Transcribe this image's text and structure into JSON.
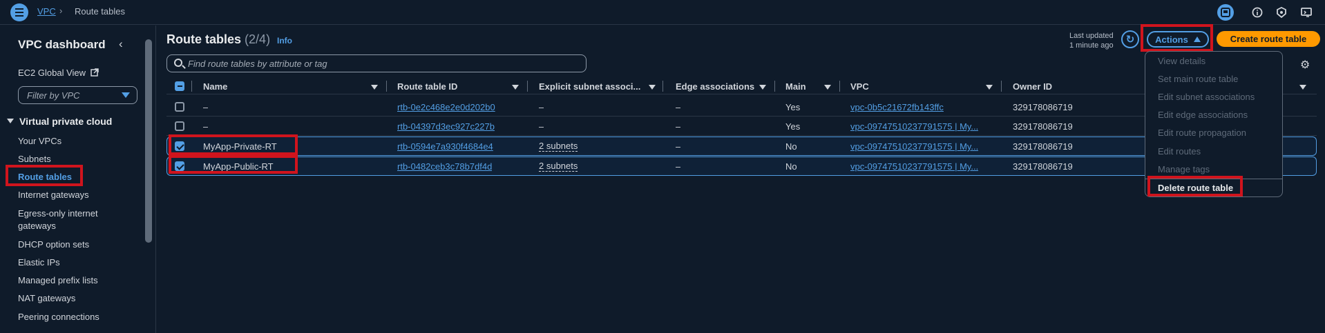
{
  "breadcrumb": {
    "service": "VPC",
    "current": "Route tables"
  },
  "sidebar": {
    "title": "VPC dashboard",
    "ec2_link": "EC2 Global View",
    "filter_placeholder": "Filter by VPC",
    "section": "Virtual private cloud",
    "items": [
      {
        "label": "Your VPCs"
      },
      {
        "label": "Subnets"
      },
      {
        "label": "Route tables"
      },
      {
        "label": "Internet gateways"
      },
      {
        "label": "Egress-only internet"
      },
      {
        "label": "gateways"
      },
      {
        "label": "DHCP option sets"
      },
      {
        "label": "Elastic IPs"
      },
      {
        "label": "Managed prefix lists"
      },
      {
        "label": "NAT gateways"
      },
      {
        "label": "Peering connections"
      }
    ]
  },
  "header": {
    "title": "Route tables",
    "count": "(2/4)",
    "info": "Info",
    "last_updated_label": "Last updated",
    "last_updated_value": "1 minute ago",
    "actions_label": "Actions",
    "create_label": "Create route table"
  },
  "search": {
    "placeholder": "Find route tables by attribute or tag"
  },
  "table": {
    "columns": [
      "Name",
      "Route table ID",
      "Explicit subnet associ...",
      "Edge associations",
      "Main",
      "VPC",
      "Owner ID"
    ],
    "rows": [
      {
        "name": "–",
        "id": "rtb-0e2c468e2e0d202b0",
        "subnets": "–",
        "edge": "–",
        "main": "Yes",
        "vpc": "vpc-0b5c21672fb143ffc",
        "owner": "329178086719",
        "selected": false
      },
      {
        "name": "–",
        "id": "rtb-04397d3ec927c227b",
        "subnets": "–",
        "edge": "–",
        "main": "Yes",
        "vpc": "vpc-09747510237791575 | My...",
        "owner": "329178086719",
        "selected": false
      },
      {
        "name": "MyApp-Private-RT",
        "id": "rtb-0594e7a930f4684e4",
        "subnets": "2 subnets",
        "edge": "–",
        "main": "No",
        "vpc": "vpc-09747510237791575 | My...",
        "owner": "329178086719",
        "selected": true
      },
      {
        "name": "MyApp-Public-RT",
        "id": "rtb-0482ceb3c78b7df4d",
        "subnets": "2 subnets",
        "edge": "–",
        "main": "No",
        "vpc": "vpc-09747510237791575 | My...",
        "owner": "329178086719",
        "selected": true
      }
    ]
  },
  "actions_menu": {
    "items": [
      {
        "label": "View details",
        "enabled": false
      },
      {
        "label": "Set main route table",
        "enabled": false
      },
      {
        "label": "Edit subnet associations",
        "enabled": false
      },
      {
        "label": "Edit edge associations",
        "enabled": false
      },
      {
        "label": "Edit route propagation",
        "enabled": false
      },
      {
        "label": "Edit routes",
        "enabled": false
      },
      {
        "label": "Manage tags",
        "enabled": false
      },
      {
        "label": "Delete route table",
        "enabled": true
      }
    ]
  },
  "colors": {
    "accent": "#539fe5",
    "primary_button": "#ff9900",
    "highlight": "#d0141d",
    "background": "#0f1b2a"
  }
}
